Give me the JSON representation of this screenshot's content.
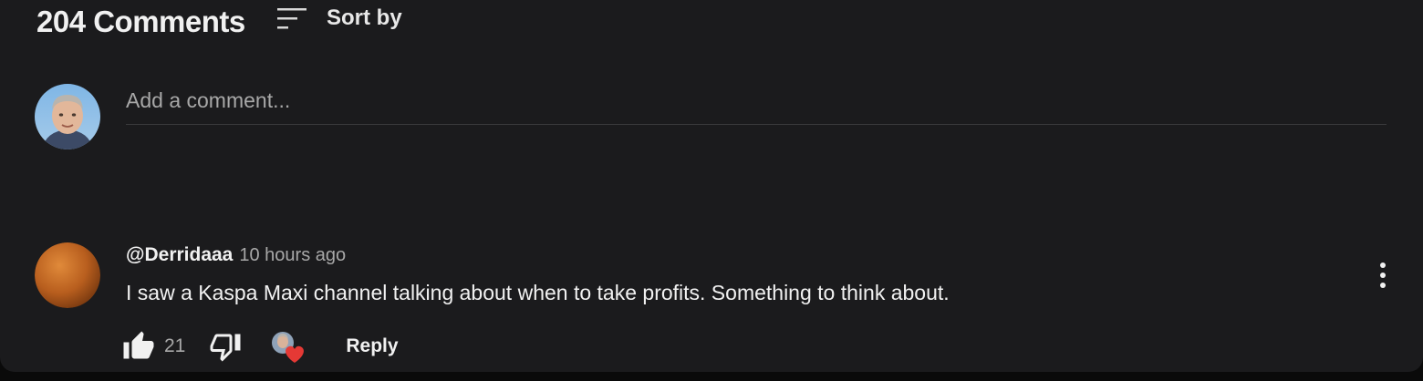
{
  "header": {
    "count_label": "204 Comments",
    "sort_label": "Sort by",
    "sort_icon": "sort-icon"
  },
  "add_comment": {
    "placeholder": "Add a comment...",
    "avatar_icon": "user-avatar"
  },
  "comments": [
    {
      "author": "@Derridaaa",
      "time": "10 hours ago",
      "text": "I saw a Kaspa Maxi channel talking about when to take profits. Something to think about.",
      "likes": "21",
      "reply_label": "Reply",
      "icons": [
        "thumbs-up-icon",
        "thumbs-down-icon",
        "creator-heart-icon",
        "more-vert-icon"
      ]
    }
  ],
  "colors": {
    "background": "#1b1b1d",
    "text_primary": "#f1f1f1",
    "text_secondary": "#a8a8a8",
    "heart": "#e53935"
  }
}
